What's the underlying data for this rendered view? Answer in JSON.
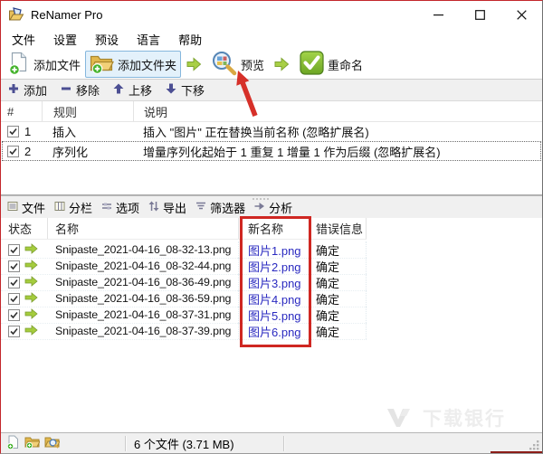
{
  "window": {
    "title": "ReNamer Pro"
  },
  "menu": {
    "items": [
      "文件",
      "设置",
      "预设",
      "语言",
      "帮助"
    ]
  },
  "toolbar": {
    "add_files": "添加文件",
    "add_folders": "添加文件夹",
    "preview": "预览",
    "rename": "重命名"
  },
  "rules_toolbar": {
    "add": "添加",
    "remove": "移除",
    "move_up": "上移",
    "move_down": "下移"
  },
  "rules": {
    "headers": {
      "num": "#",
      "rule": "规则",
      "desc": "说明"
    },
    "rows": [
      {
        "num": "1",
        "rule": "插入",
        "desc": "插入 \"图片\" 正在替换当前名称 (忽略扩展名)",
        "checked": true
      },
      {
        "num": "2",
        "rule": "序列化",
        "desc": "增量序列化起始于 1 重复 1 增量 1 作为后缀 (忽略扩展名)",
        "checked": true
      }
    ]
  },
  "tabs": {
    "items": [
      "文件",
      "分栏",
      "选项",
      "导出",
      "筛选器",
      "分析"
    ]
  },
  "files": {
    "headers": {
      "status": "状态",
      "name": "名称",
      "new_name": "新名称",
      "error": "错误信息"
    },
    "rows": [
      {
        "name": "Snipaste_2021-04-16_08-32-13.png",
        "new_name": "图片1.png",
        "error": "确定",
        "checked": true
      },
      {
        "name": "Snipaste_2021-04-16_08-32-44.png",
        "new_name": "图片2.png",
        "error": "确定",
        "checked": true
      },
      {
        "name": "Snipaste_2021-04-16_08-36-49.png",
        "new_name": "图片3.png",
        "error": "确定",
        "checked": true
      },
      {
        "name": "Snipaste_2021-04-16_08-36-59.png",
        "new_name": "图片4.png",
        "error": "确定",
        "checked": true
      },
      {
        "name": "Snipaste_2021-04-16_08-37-31.png",
        "new_name": "图片5.png",
        "error": "确定",
        "checked": true
      },
      {
        "name": "Snipaste_2021-04-16_08-37-39.png",
        "new_name": "图片6.png",
        "error": "确定",
        "checked": true
      }
    ]
  },
  "statusbar": {
    "text": "6 个文件 (3.71 MB)"
  },
  "watermark": {
    "text": "下载银行"
  },
  "icons": {
    "app": "renamer-folder-logo",
    "add_file": "page-with-green-plus",
    "add_folder": "folder-with-green-plus",
    "preview": "magnifier-over-window",
    "rename": "green-check-square",
    "flow": "green-right-block-arrow",
    "status_row": "green-right-arrow",
    "rules_add": "blue-plus",
    "rules_remove": "blue-minus",
    "rules_up": "blue-up-arrow",
    "rules_down": "blue-down-arrow"
  },
  "colors": {
    "annotation_red": "#cf2722",
    "new_name_blue": "#2a2ac0",
    "accent_green": "#8dc63f",
    "toolbar_icon_blue": "#4c4f93",
    "highlight_bg": "#e3f1fb"
  }
}
